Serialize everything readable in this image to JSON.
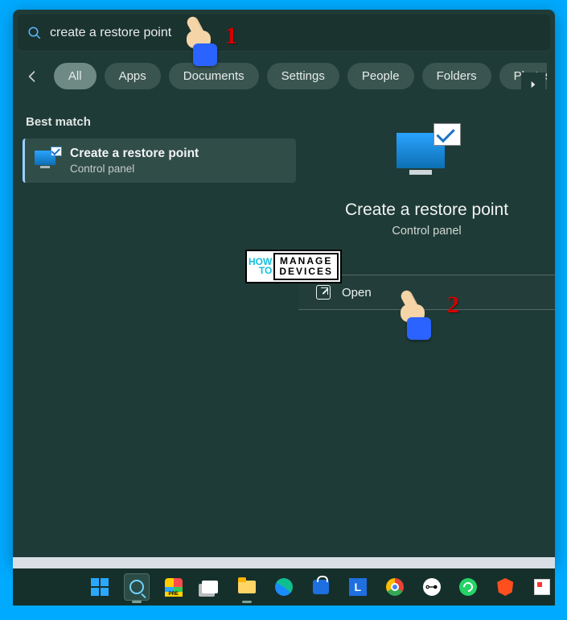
{
  "search": {
    "query": "create a restore point"
  },
  "filters": {
    "items": [
      "All",
      "Apps",
      "Documents",
      "Settings",
      "People",
      "Folders",
      "Photos"
    ],
    "active_index": 0
  },
  "left_panel": {
    "section_title": "Best match",
    "result": {
      "title": "Create a restore point",
      "subtitle": "Control panel"
    }
  },
  "right_panel": {
    "title": "Create a restore point",
    "subtitle": "Control panel",
    "open_label": "Open"
  },
  "callouts": {
    "one": "1",
    "two": "2"
  },
  "watermark": {
    "left_top": "HOW",
    "left_bottom": "TO",
    "right_top": "MANAGE",
    "right_bottom": "DEVICES"
  },
  "taskbar": {
    "items": [
      {
        "name": "start",
        "active": false
      },
      {
        "name": "search",
        "active": true
      },
      {
        "name": "copilot",
        "active": false
      },
      {
        "name": "task-view",
        "active": false
      },
      {
        "name": "file-explorer",
        "active": false
      },
      {
        "name": "edge",
        "active": false
      },
      {
        "name": "microsoft-store",
        "active": false
      },
      {
        "name": "linkedin",
        "active": false
      },
      {
        "name": "chrome",
        "active": false
      },
      {
        "name": "keepass",
        "active": false
      },
      {
        "name": "whatsapp",
        "active": false
      },
      {
        "name": "brave",
        "active": false
      },
      {
        "name": "misc",
        "active": false
      }
    ],
    "linkedin_letter": "L"
  }
}
